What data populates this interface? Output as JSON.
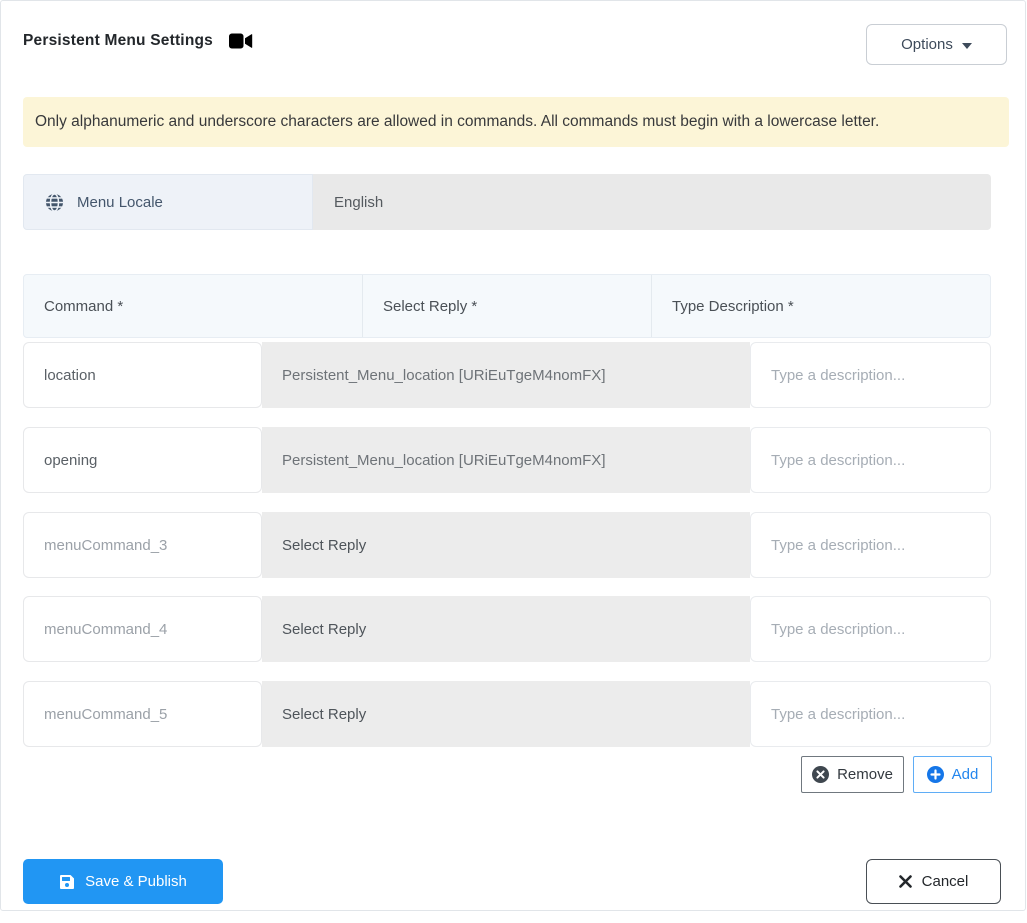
{
  "header": {
    "title": "Persistent Menu Settings",
    "options_button": "Options"
  },
  "banner": {
    "text": "Only alphanumeric and underscore characters are allowed in commands. All commands must begin with a lowercase letter."
  },
  "locale": {
    "label": "Menu Locale",
    "value": "English"
  },
  "table": {
    "headers": {
      "command": "Command *",
      "reply": "Select Reply *",
      "description": "Type Description *"
    },
    "rows": [
      {
        "command_value": "location",
        "command_placeholder": "",
        "reply": "Persistent_Menu_location [URiEuTgeM4nomFX]",
        "description_value": "",
        "description_placeholder": "Type a description..."
      },
      {
        "command_value": "opening",
        "command_placeholder": "",
        "reply": "Persistent_Menu_location [URiEuTgeM4nomFX]",
        "description_value": "",
        "description_placeholder": "Type a description..."
      },
      {
        "command_value": "",
        "command_placeholder": "menuCommand_3",
        "reply": "Select Reply",
        "description_value": "",
        "description_placeholder": "Type a description..."
      },
      {
        "command_value": "",
        "command_placeholder": "menuCommand_4",
        "reply": "Select Reply",
        "description_value": "",
        "description_placeholder": "Type a description..."
      },
      {
        "command_value": "",
        "command_placeholder": "menuCommand_5",
        "reply": "Select Reply",
        "description_value": "",
        "description_placeholder": "Type a description..."
      }
    ]
  },
  "row_actions": {
    "remove": "Remove",
    "add": "Add"
  },
  "footer": {
    "save": "Save & Publish",
    "cancel": "Cancel"
  },
  "colors": {
    "primary_blue": "#2196f3",
    "add_blue": "#2386ee",
    "banner_bg": "#fcf5d7",
    "locale_label_bg": "#eef2f8",
    "disabled_field_bg": "#e9e9e9",
    "table_header_bg": "#f5f9fc",
    "reply_cell_bg": "#ececec"
  }
}
